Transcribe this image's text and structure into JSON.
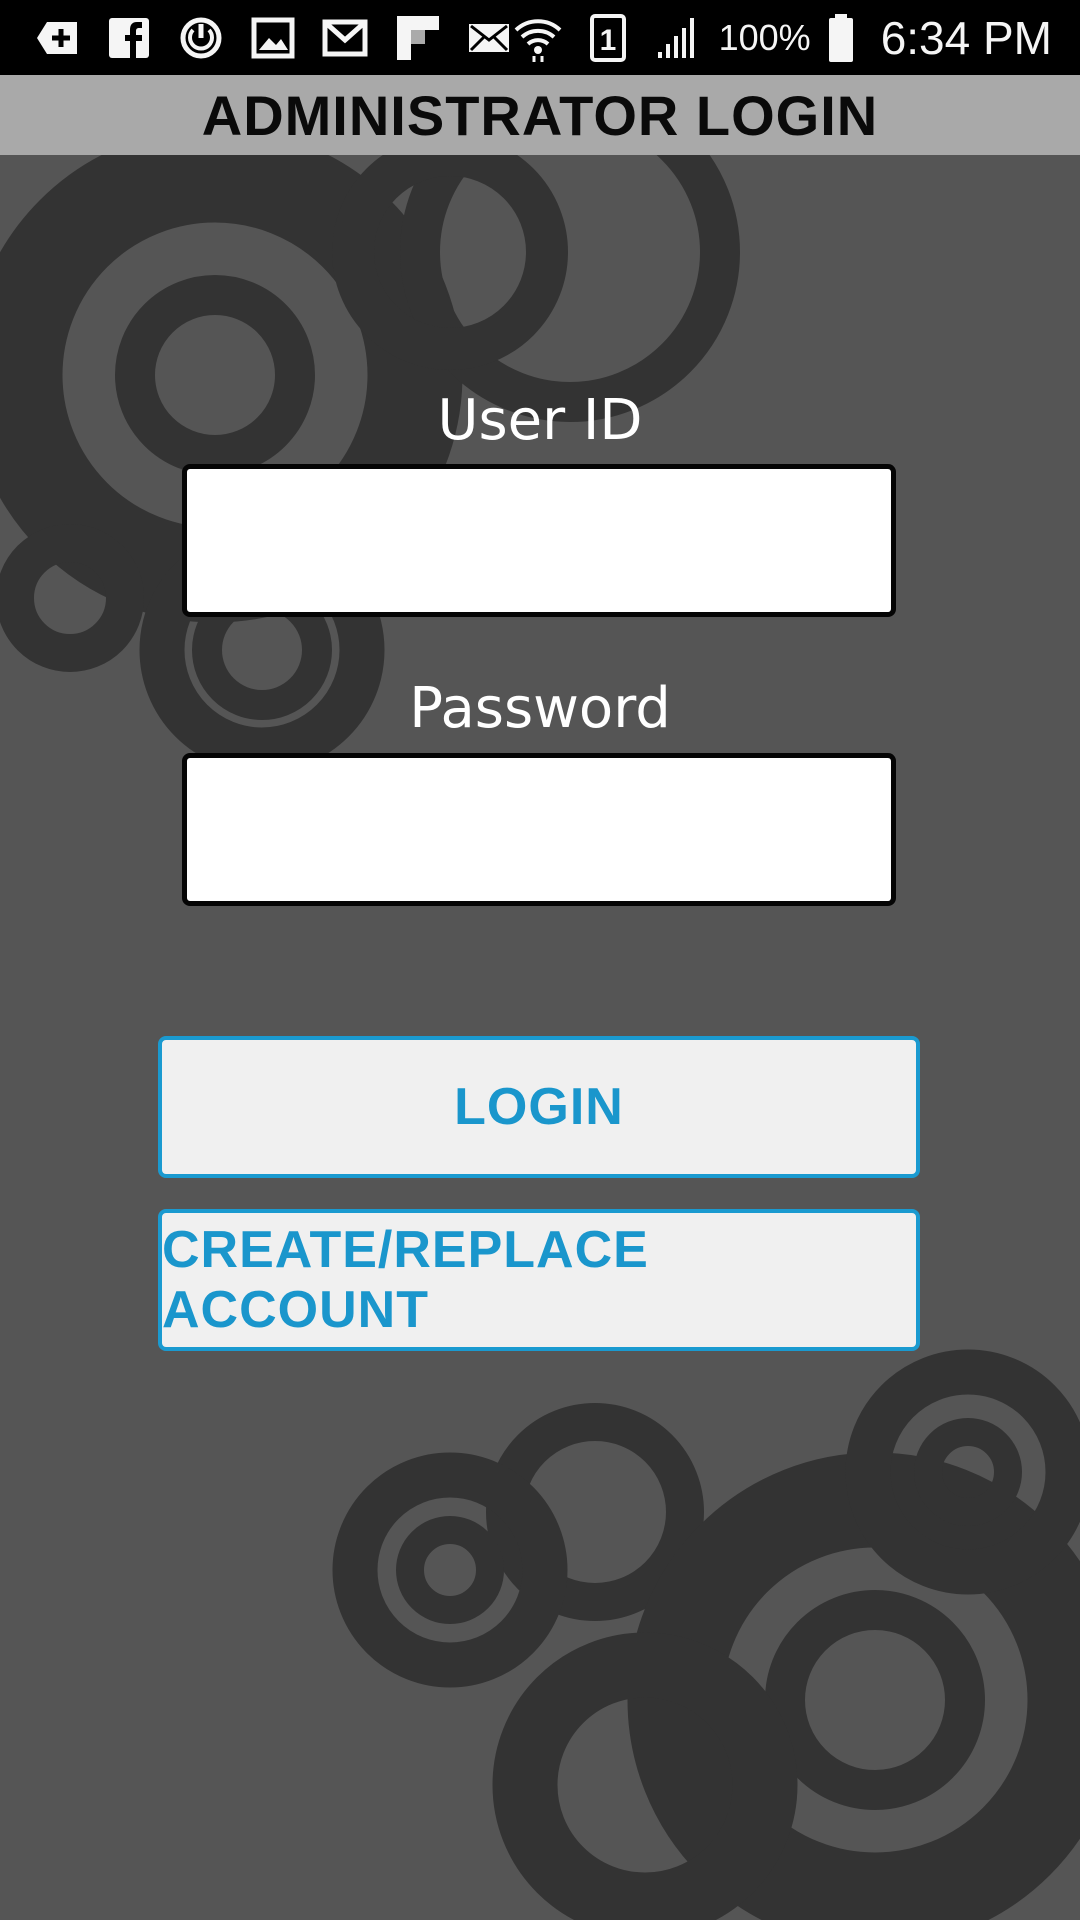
{
  "status_bar": {
    "left_icons": [
      "add-notification-icon",
      "facebook-icon",
      "sync-icon",
      "gallery-icon",
      "gmail-icon",
      "flipboard-icon",
      "email-icon"
    ],
    "right_icons": [
      "wifi-icon",
      "sim-1-icon",
      "signal-icon",
      "battery-icon"
    ],
    "sim_label": "1",
    "battery_percent": "100%",
    "time": "6:34 PM"
  },
  "header": {
    "title": "ADMINISTRATOR LOGIN"
  },
  "form": {
    "user_id_label": "User ID",
    "user_id_value": "",
    "password_label": "Password",
    "password_value": ""
  },
  "buttons": {
    "login_label": "LOGIN",
    "create_label": "CREATE/REPLACE ACCOUNT"
  },
  "colors": {
    "background": "#555555",
    "title_bar": "#a9a9a9",
    "accent": "#1a9ad0",
    "button_fill": "#f0f0f0"
  }
}
